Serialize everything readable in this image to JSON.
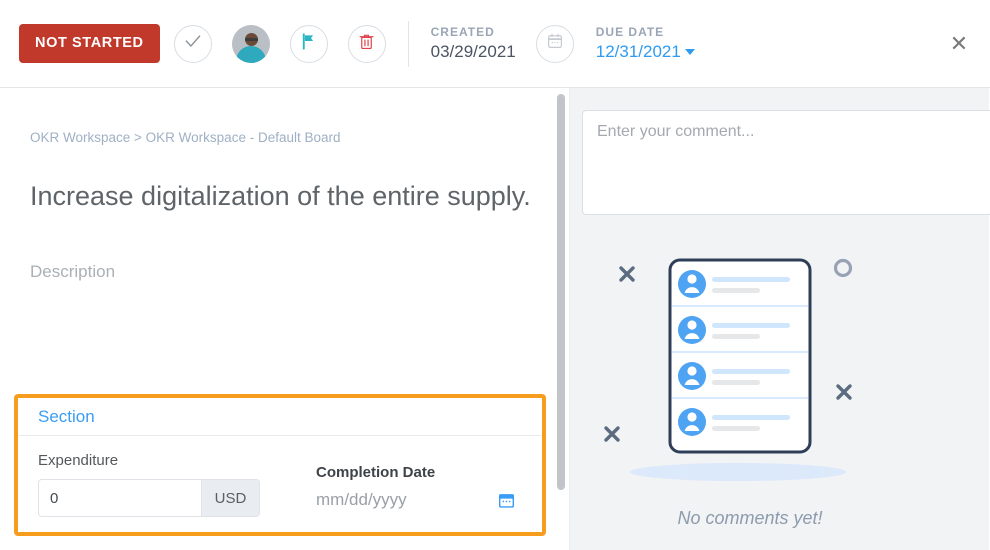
{
  "header": {
    "status_label": "NOT STARTED",
    "status_color": "#c0392b",
    "complete_icon": "check-circle-icon",
    "avatar_icon": "user-avatar",
    "flag_icon": "flag-icon",
    "flag_color": "#2ab5c4",
    "delete_icon": "trash-icon",
    "delete_color": "#e0424a",
    "created_label": "CREATED",
    "created_value": "03/29/2021",
    "calendar_icon": "calendar-icon",
    "due_label": "DUE DATE",
    "due_value": "12/31/2021",
    "due_color": "#2e9bf0",
    "close_icon": "✕"
  },
  "left": {
    "breadcrumb": "OKR Workspace > OKR Workspace - Default Board",
    "title": "Increase digitalization of the entire supply.",
    "description": "Description",
    "section": {
      "title": "Section",
      "title_color": "#3b9cf5",
      "highlight_color": "#f79d1e",
      "expenditure_label": "Expenditure",
      "expenditure_value": "0",
      "expenditure_placeholder": "0",
      "currency_addon": "USD",
      "completion_label": "Completion Date",
      "completion_placeholder": "mm/dd/yyyy",
      "completion_value": "",
      "completion_icon": "calendar-icon"
    }
  },
  "right": {
    "comment_placeholder": "Enter your comment...",
    "comment_value": "",
    "empty_state_text": "No comments yet!",
    "empty_state_icon": "comment-list-illustration"
  }
}
